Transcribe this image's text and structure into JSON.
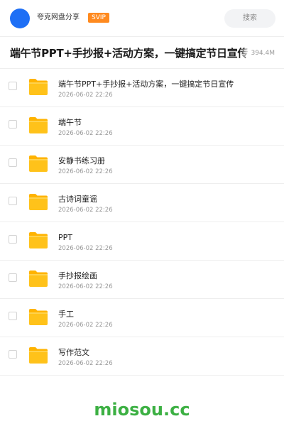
{
  "header": {
    "owner_name": "夸克网盘分享",
    "badge": "SVIP",
    "search_label": "搜索"
  },
  "share": {
    "title": "端午节PPT+手抄报+活动方案，一键搞定节日宣传",
    "size": "394.4M"
  },
  "items": [
    {
      "name": "端午节PPT+手抄报+活动方案，一键搞定节日宣传",
      "date": "2026-06-02 22:26",
      "icon": "folder-icon"
    },
    {
      "name": "端午节",
      "date": "2026-06-02 22:26",
      "icon": "folder-icon"
    },
    {
      "name": "安静书练习册",
      "date": "2026-06-02 22:26",
      "icon": "folder-icon"
    },
    {
      "name": "古诗词童谣",
      "date": "2026-06-02 22:26",
      "icon": "folder-icon"
    },
    {
      "name": "PPT",
      "date": "2026-06-02 22:26",
      "icon": "folder-icon"
    },
    {
      "name": "手抄报绘画",
      "date": "2026-06-02 22:26",
      "icon": "folder-icon"
    },
    {
      "name": "手工",
      "date": "2026-06-02 22:26",
      "icon": "folder-icon"
    },
    {
      "name": "写作范文",
      "date": "2026-06-02 22:26",
      "icon": "folder-icon"
    }
  ],
  "watermark": "miosou.cc",
  "colors": {
    "avatar": "#1e6ff5",
    "badge": "#ff8a1f",
    "folder": "#ffc21a",
    "watermark": "#3cb043"
  }
}
